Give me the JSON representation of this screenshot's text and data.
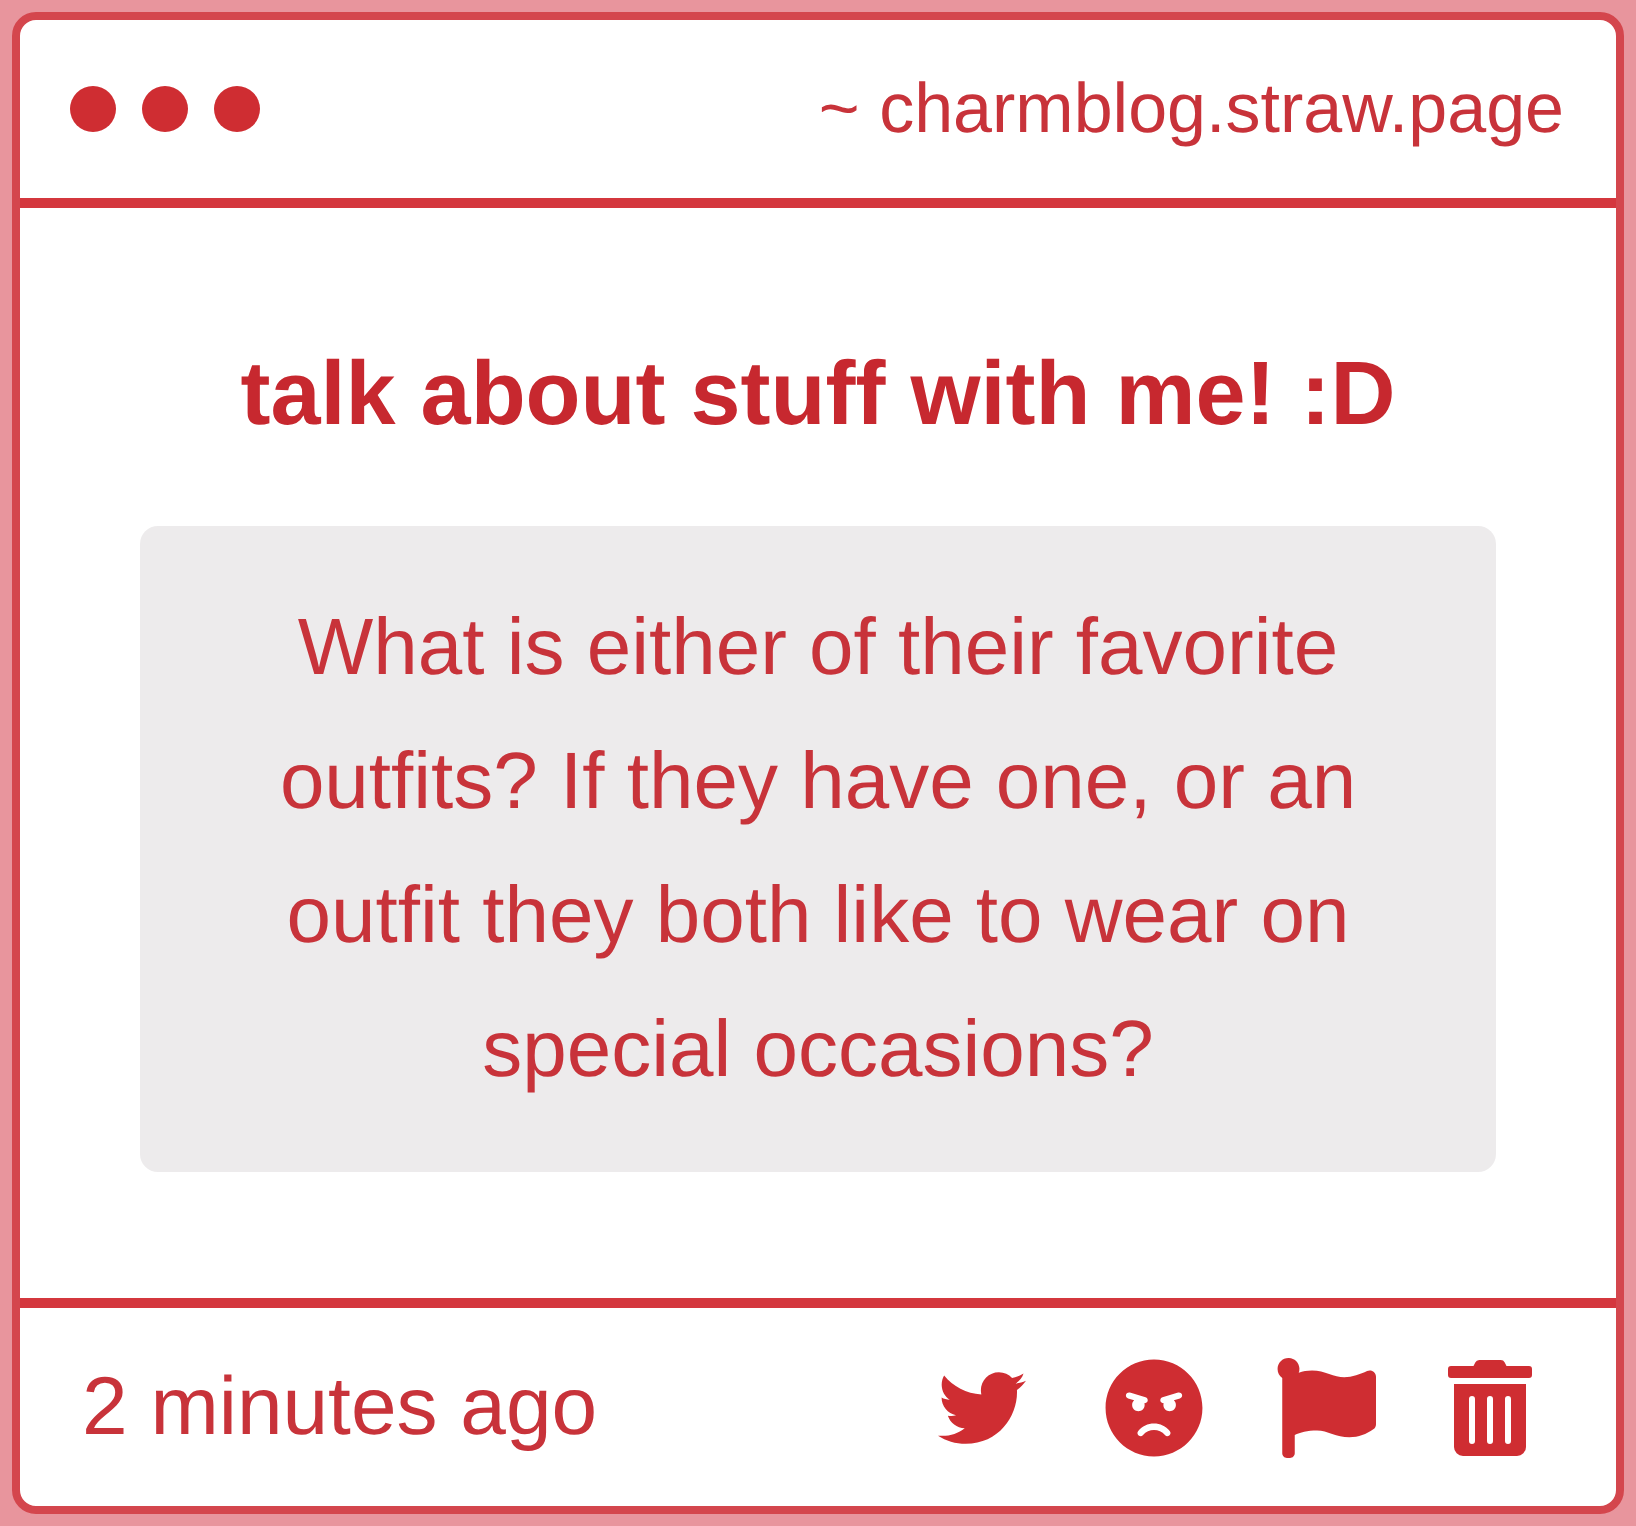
{
  "window": {
    "url": "~ charmblog.straw.page"
  },
  "post": {
    "title": "talk about stuff with me! :D",
    "question": "What is either of their favorite outfits? If they have one, or an outfit they both like to wear on special occasions?"
  },
  "footer": {
    "timestamp": "2 minutes ago"
  }
}
